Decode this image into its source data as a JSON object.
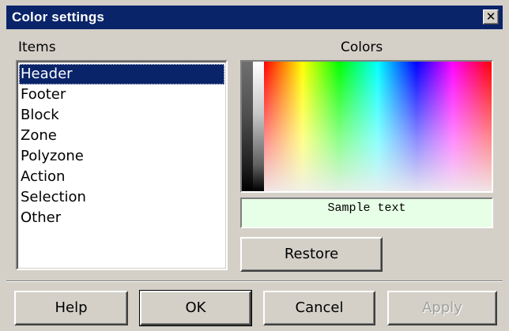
{
  "window": {
    "title": "Color settings",
    "close_glyph": "✕",
    "close_icon": "close-icon"
  },
  "items_panel": {
    "label": "Items",
    "items": [
      {
        "label": "Header",
        "selected": true
      },
      {
        "label": "Footer",
        "selected": false
      },
      {
        "label": "Block",
        "selected": false
      },
      {
        "label": "Zone",
        "selected": false
      },
      {
        "label": "Polyzone",
        "selected": false
      },
      {
        "label": "Action",
        "selected": false
      },
      {
        "label": "Selection",
        "selected": false
      },
      {
        "label": "Other",
        "selected": false
      }
    ]
  },
  "colors_panel": {
    "label": "Colors",
    "sample_text": "Sample text",
    "sample_background": "#e6ffe6",
    "restore_label": "Restore"
  },
  "buttons": {
    "help": "Help",
    "ok": "OK",
    "cancel": "Cancel",
    "apply": "Apply",
    "apply_disabled": true
  },
  "colors": {
    "titlebar": "#0a246a",
    "selection": "#0a246a",
    "face": "#d4d0c8"
  }
}
